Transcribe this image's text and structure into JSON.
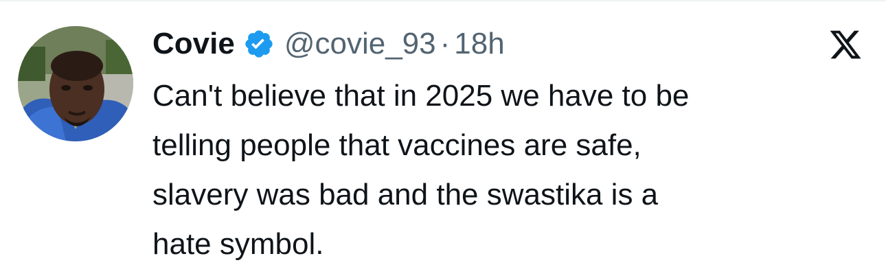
{
  "tweet": {
    "display_name": "Covie",
    "handle": "@covie_93",
    "separator": "·",
    "time": "18h",
    "text_lines": [
      "Can't believe that in 2025 we have to be",
      "telling people that vaccines are safe,",
      "slavery was bad and the swastika is a",
      "hate symbol."
    ]
  },
  "icons": {
    "verified": "verified-badge-icon",
    "brand": "x-logo-icon",
    "avatar": "user-avatar"
  },
  "colors": {
    "text_primary": "#0f1419",
    "text_secondary": "#536471",
    "verified_blue": "#1d9bf0"
  }
}
